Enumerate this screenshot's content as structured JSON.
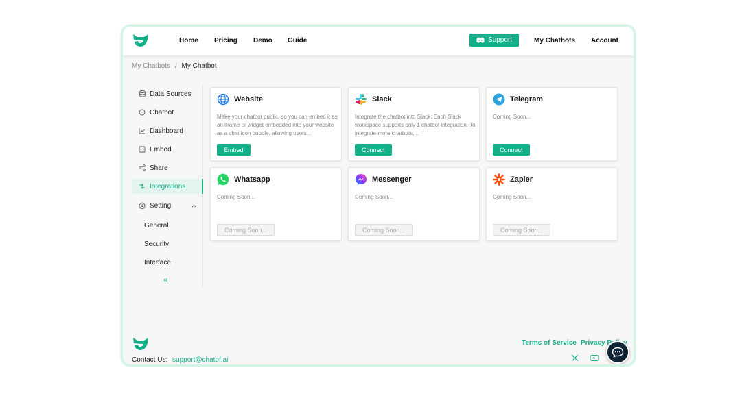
{
  "nav": {
    "links": [
      "Home",
      "Pricing",
      "Demo",
      "Guide"
    ],
    "support_label": "Support",
    "my_chatbots": "My Chatbots",
    "account": "Account"
  },
  "breadcrumb": {
    "parent": "My Chatbots",
    "separator": "/",
    "current": "My Chatbot"
  },
  "sidebar": {
    "items": [
      {
        "label": "Data Sources",
        "icon": "database-icon"
      },
      {
        "label": "Chatbot",
        "icon": "chat-icon"
      },
      {
        "label": "Dashboard",
        "icon": "chart-icon"
      },
      {
        "label": "Embed",
        "icon": "embed-icon"
      },
      {
        "label": "Share",
        "icon": "share-icon"
      },
      {
        "label": "Integrations",
        "icon": "integrations-icon",
        "active": true
      },
      {
        "label": "Setting",
        "icon": "gear-icon"
      }
    ],
    "sub_items": [
      "General",
      "Security",
      "Interface"
    ],
    "collapse_glyph": "«"
  },
  "cards": [
    {
      "title": "Website",
      "desc": "Make your chatbot public, so you can embed it as an iframe or widget embedded into your website as a chat icon bubble, allowing users...",
      "button": "Embed",
      "enabled": true
    },
    {
      "title": "Slack",
      "desc": "Integrate the chatbot into Slack. Each Slack workspace supports only 1 chatbot integration. To integrate more chatbots,...",
      "button": "Connect",
      "enabled": true
    },
    {
      "title": "Telegram",
      "desc": "Coming Soon...",
      "button": "Connect",
      "enabled": true
    },
    {
      "title": "Whatsapp",
      "desc": "Coming Soon...",
      "button": "Coming Soon...",
      "enabled": false
    },
    {
      "title": "Messenger",
      "desc": "Coming Soon...",
      "button": "Coming Soon...",
      "enabled": false
    },
    {
      "title": "Zapier",
      "desc": "Coming Soon...",
      "button": "Coming Soon...",
      "enabled": false
    }
  ],
  "footer": {
    "contact_label": "Contact Us:",
    "contact_email": "support@chatof.ai",
    "terms": "Terms of Service",
    "privacy": "Privacy Policy"
  },
  "colors": {
    "accent": "#14b08a",
    "fab": "#0f2233"
  }
}
